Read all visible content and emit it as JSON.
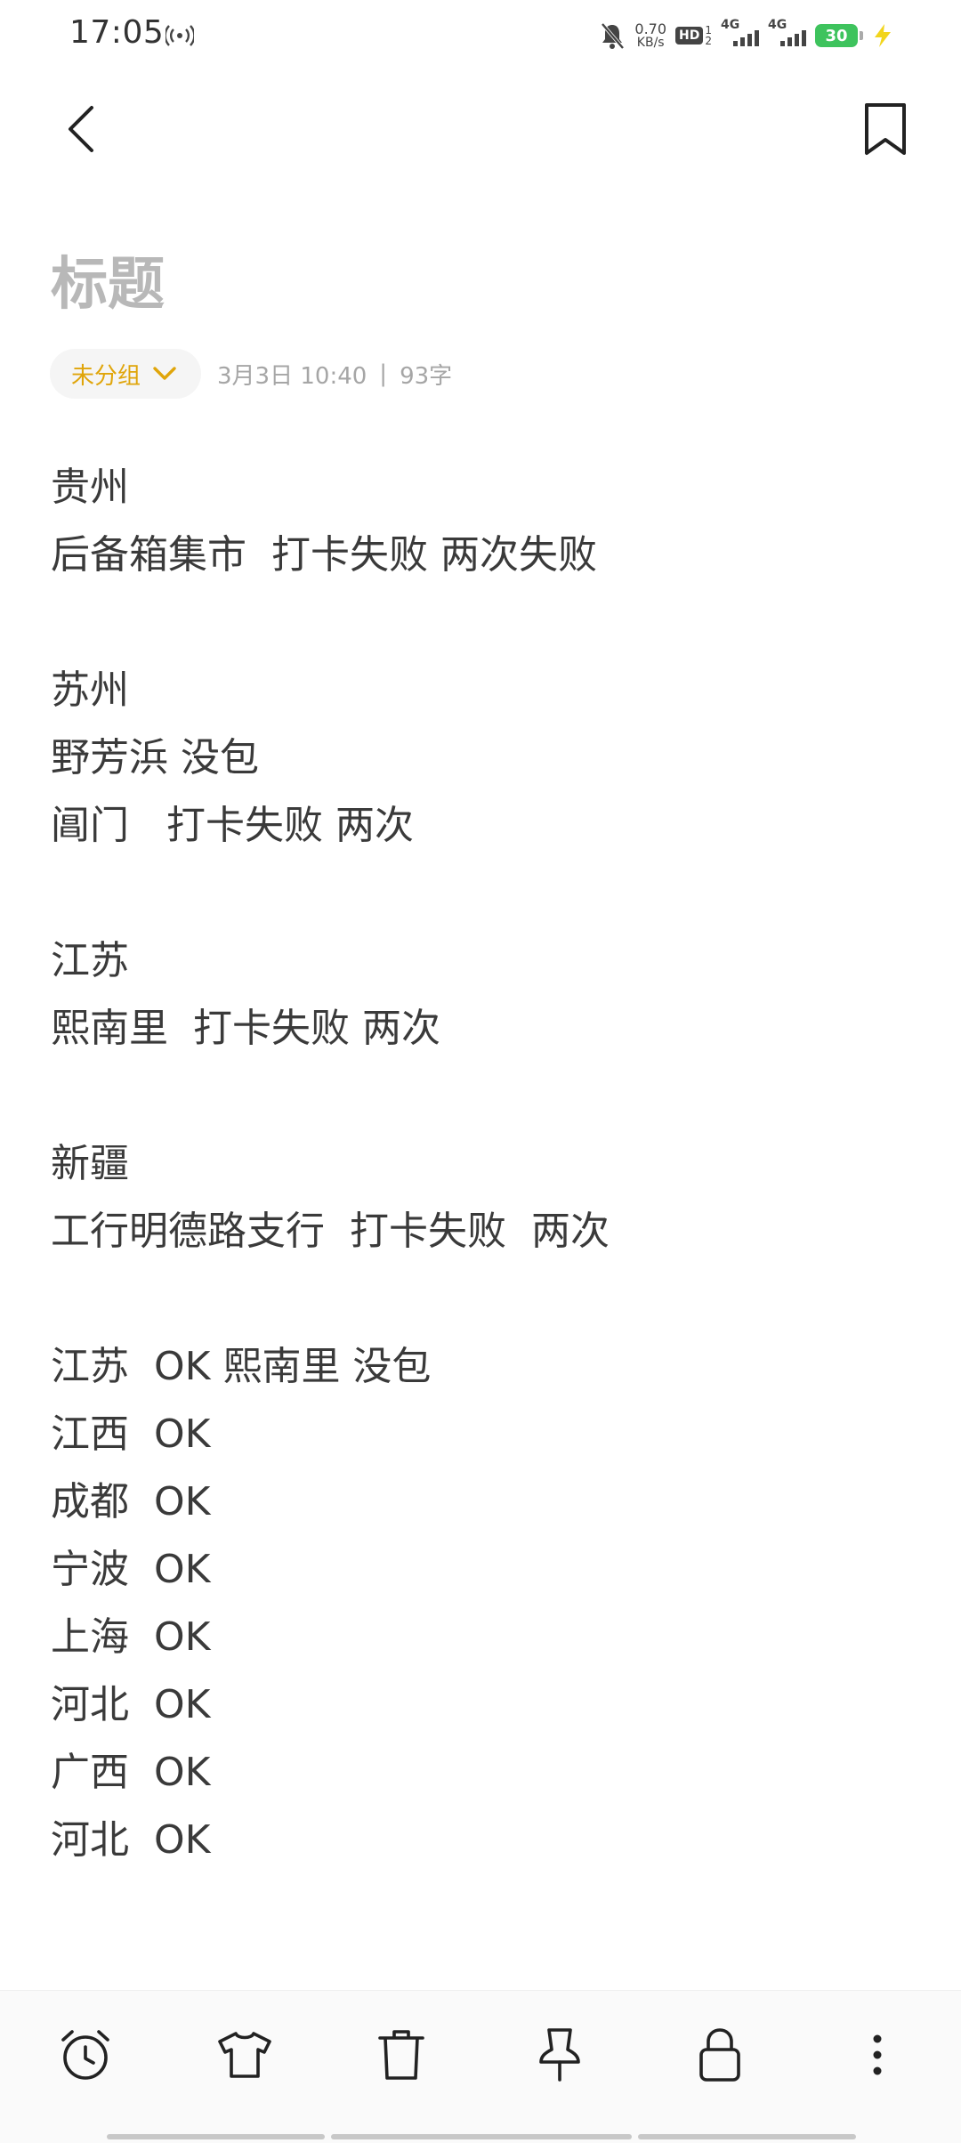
{
  "status_bar": {
    "time": "17:05",
    "net_speed_value": "0.70",
    "net_speed_unit": "KB/s",
    "hd_label": "HD",
    "hd_sub_top": "1",
    "hd_sub_bottom": "2",
    "signal1_label": "4G",
    "signal2_label": "4G",
    "battery_level": "30",
    "battery_color": "#3ec35d",
    "icons": [
      "hotspot-icon",
      "mute-bell-icon",
      "signal-icon",
      "battery-icon",
      "charging-icon"
    ]
  },
  "nav": {
    "back_icon": "chevron-left-icon",
    "bookmark_icon": "bookmark-icon"
  },
  "note": {
    "title_placeholder": "标题",
    "group_label": "未分组",
    "group_accent": "#e0a50a",
    "date": "3月3日 10:40",
    "separator": "|",
    "word_count": "93字",
    "lines": [
      "贵州",
      "后备箱集市  打卡失败 两次失败",
      "",
      "苏州",
      "野芳浜 没包",
      "阊门   打卡失败 两次",
      "",
      "江苏",
      "熙南里  打卡失败 两次",
      "",
      "新疆",
      "工行明德路支行  打卡失败  两次",
      "",
      "江苏  OK 熙南里 没包",
      "江西  OK",
      "成都  OK",
      "宁波  OK",
      "上海  OK",
      "河北  OK",
      "广西  OK",
      "河北  OK"
    ]
  },
  "toolbar": {
    "items": [
      "alarm-clock-icon",
      "shirt-icon",
      "trash-icon",
      "pin-icon",
      "lock-icon",
      "more-vertical-icon"
    ]
  }
}
